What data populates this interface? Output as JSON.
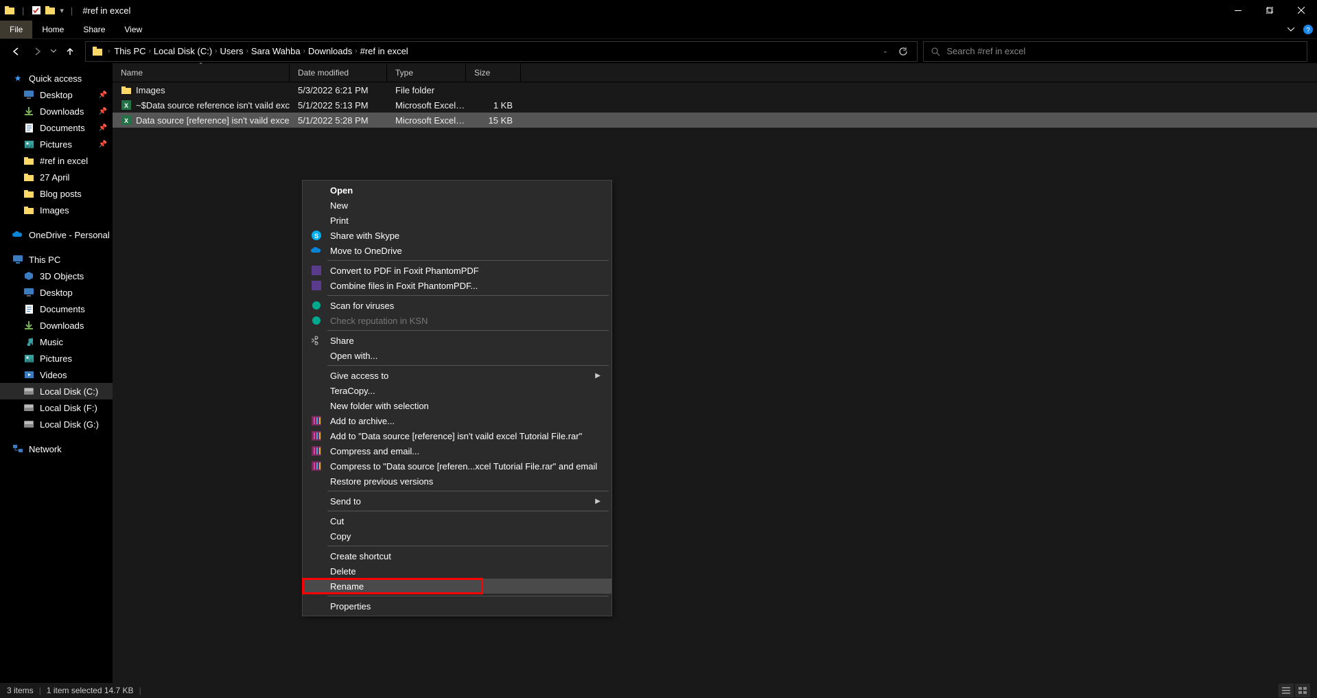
{
  "title": "#ref in excel",
  "ribbon": {
    "file": "File",
    "home": "Home",
    "share": "Share",
    "view": "View"
  },
  "breadcrumb": [
    "This PC",
    "Local Disk (C:)",
    "Users",
    "Sara Wahba",
    "Downloads",
    "#ref in excel"
  ],
  "search_placeholder": "Search #ref in excel",
  "columns": {
    "name": "Name",
    "date": "Date modified",
    "type": "Type",
    "size": "Size"
  },
  "sidebar": {
    "quick_access": "Quick access",
    "qa_items": [
      {
        "label": "Desktop",
        "pinned": true,
        "icon": "desktop"
      },
      {
        "label": "Downloads",
        "pinned": true,
        "icon": "downloads"
      },
      {
        "label": "Documents",
        "pinned": true,
        "icon": "documents"
      },
      {
        "label": "Pictures",
        "pinned": true,
        "icon": "pictures"
      },
      {
        "label": "#ref in excel",
        "pinned": false,
        "icon": "folder"
      },
      {
        "label": "27 April",
        "pinned": false,
        "icon": "folder"
      },
      {
        "label": "Blog posts",
        "pinned": false,
        "icon": "folder"
      },
      {
        "label": "Images",
        "pinned": false,
        "icon": "folder"
      }
    ],
    "onedrive": "OneDrive - Personal",
    "this_pc": "This PC",
    "pc_items": [
      {
        "label": "3D Objects",
        "icon": "3d"
      },
      {
        "label": "Desktop",
        "icon": "desktop"
      },
      {
        "label": "Documents",
        "icon": "documents"
      },
      {
        "label": "Downloads",
        "icon": "downloads"
      },
      {
        "label": "Music",
        "icon": "music"
      },
      {
        "label": "Pictures",
        "icon": "pictures"
      },
      {
        "label": "Videos",
        "icon": "videos"
      },
      {
        "label": "Local Disk (C:)",
        "icon": "disk",
        "selected": true
      },
      {
        "label": "Local Disk (F:)",
        "icon": "disk"
      },
      {
        "label": "Local Disk (G:)",
        "icon": "disk"
      }
    ],
    "network": "Network"
  },
  "files": [
    {
      "name": "Images",
      "date": "5/3/2022 6:21 PM",
      "type": "File folder",
      "size": "",
      "icon": "folder"
    },
    {
      "name": "~$Data source reference isn't vaild excel ...",
      "date": "5/1/2022 5:13 PM",
      "type": "Microsoft Excel W...",
      "size": "1 KB",
      "icon": "excel"
    },
    {
      "name": "Data source [reference] isn't vaild excel T...",
      "date": "5/1/2022 5:28 PM",
      "type": "Microsoft Excel W...",
      "size": "15 KB",
      "icon": "excel",
      "selected": true
    }
  ],
  "context_menu": [
    {
      "label": "Open",
      "bold": true
    },
    {
      "label": "New"
    },
    {
      "label": "Print"
    },
    {
      "label": "Share with Skype",
      "icon": "skype"
    },
    {
      "label": "Move to OneDrive",
      "icon": "onedrive"
    },
    {
      "sep": true
    },
    {
      "label": "Convert to PDF in Foxit PhantomPDF",
      "icon": "foxit"
    },
    {
      "label": "Combine files in Foxit PhantomPDF...",
      "icon": "foxit"
    },
    {
      "sep": true
    },
    {
      "label": "Scan for viruses",
      "icon": "kasp"
    },
    {
      "label": "Check reputation in KSN",
      "icon": "kasp",
      "disabled": true
    },
    {
      "sep": true
    },
    {
      "label": "Share",
      "icon": "share"
    },
    {
      "label": "Open with..."
    },
    {
      "sep": true
    },
    {
      "label": "Give access to",
      "arrow": true
    },
    {
      "label": "TeraCopy..."
    },
    {
      "label": "New folder with selection"
    },
    {
      "label": "Add to archive...",
      "icon": "rar"
    },
    {
      "label": "Add to \"Data source [reference] isn't vaild excel Tutorial File.rar\"",
      "icon": "rar"
    },
    {
      "label": "Compress and email...",
      "icon": "rar"
    },
    {
      "label": "Compress to \"Data source [referen...xcel Tutorial File.rar\" and email",
      "icon": "rar"
    },
    {
      "label": "Restore previous versions"
    },
    {
      "sep": true
    },
    {
      "label": "Send to",
      "arrow": true
    },
    {
      "sep": true
    },
    {
      "label": "Cut"
    },
    {
      "label": "Copy"
    },
    {
      "sep": true
    },
    {
      "label": "Create shortcut"
    },
    {
      "label": "Delete"
    },
    {
      "label": "Rename",
      "hover": true,
      "highlight": true
    },
    {
      "sep": true
    },
    {
      "label": "Properties"
    }
  ],
  "status": {
    "items": "3 items",
    "selected": "1 item selected  14.7 KB"
  }
}
